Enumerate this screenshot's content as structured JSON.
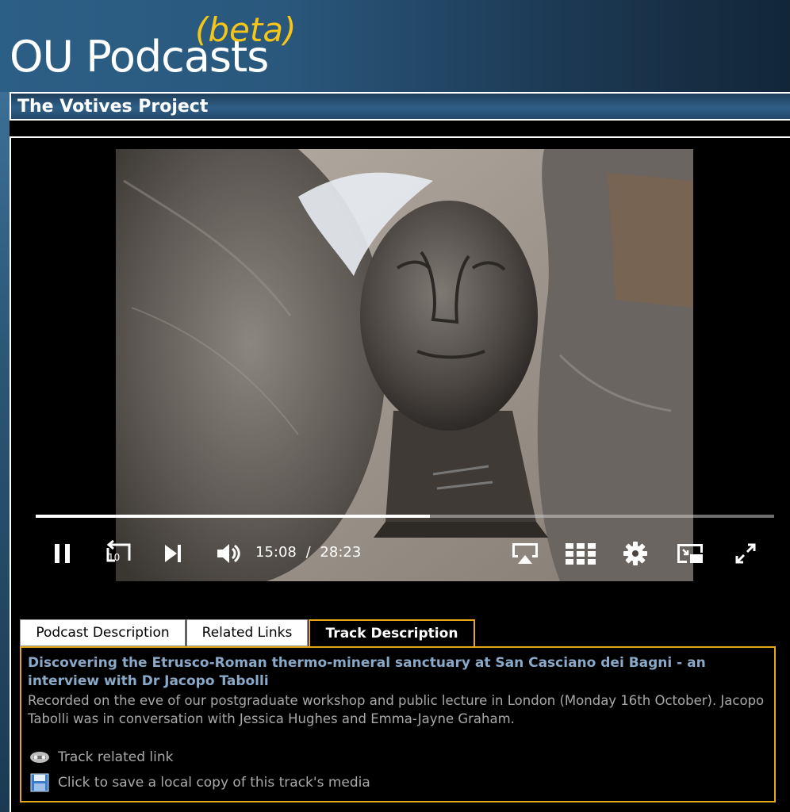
{
  "header": {
    "logo_main": "OU Podcasts",
    "logo_beta": "(beta)"
  },
  "page": {
    "title": "The Votives Project"
  },
  "player": {
    "progress_fraction": 0.534,
    "current_time": "15:08",
    "separator": "/",
    "duration": "28:23",
    "skip_back_seconds": "10",
    "icons": [
      "pause-icon",
      "rewind-10-icon",
      "next-track-icon",
      "volume-icon",
      "airplay-icon",
      "chapters-grid-icon",
      "settings-gear-icon",
      "picture-in-picture-icon",
      "fullscreen-icon"
    ]
  },
  "tabs": [
    {
      "label": "Podcast Description",
      "active": false
    },
    {
      "label": "Related Links",
      "active": false
    },
    {
      "label": "Track Description",
      "active": true
    }
  ],
  "track": {
    "title": "Discovering the Etrusco-Roman thermo-mineral sanctuary at San Casciano dei Bagni - an interview with Dr Jacopo Tabolli",
    "description": "Recorded on the eve of our postgraduate workshop and public lecture in London (Monday 16th October). Jacopo Tabolli was in conversation with Jessica Hughes and Emma-Jayne Graham.",
    "links": [
      {
        "label": "Track related link",
        "icon": "link-chain-icon"
      },
      {
        "label": "Click to save a local copy of this track's media",
        "icon": "save-disk-icon"
      }
    ]
  },
  "colors": {
    "accent": "#e6a817",
    "title_link": "#8aa8c8",
    "body_text": "#a9a9a9",
    "header_blue": "#2c5f86",
    "beta_yellow": "#f5c518"
  }
}
